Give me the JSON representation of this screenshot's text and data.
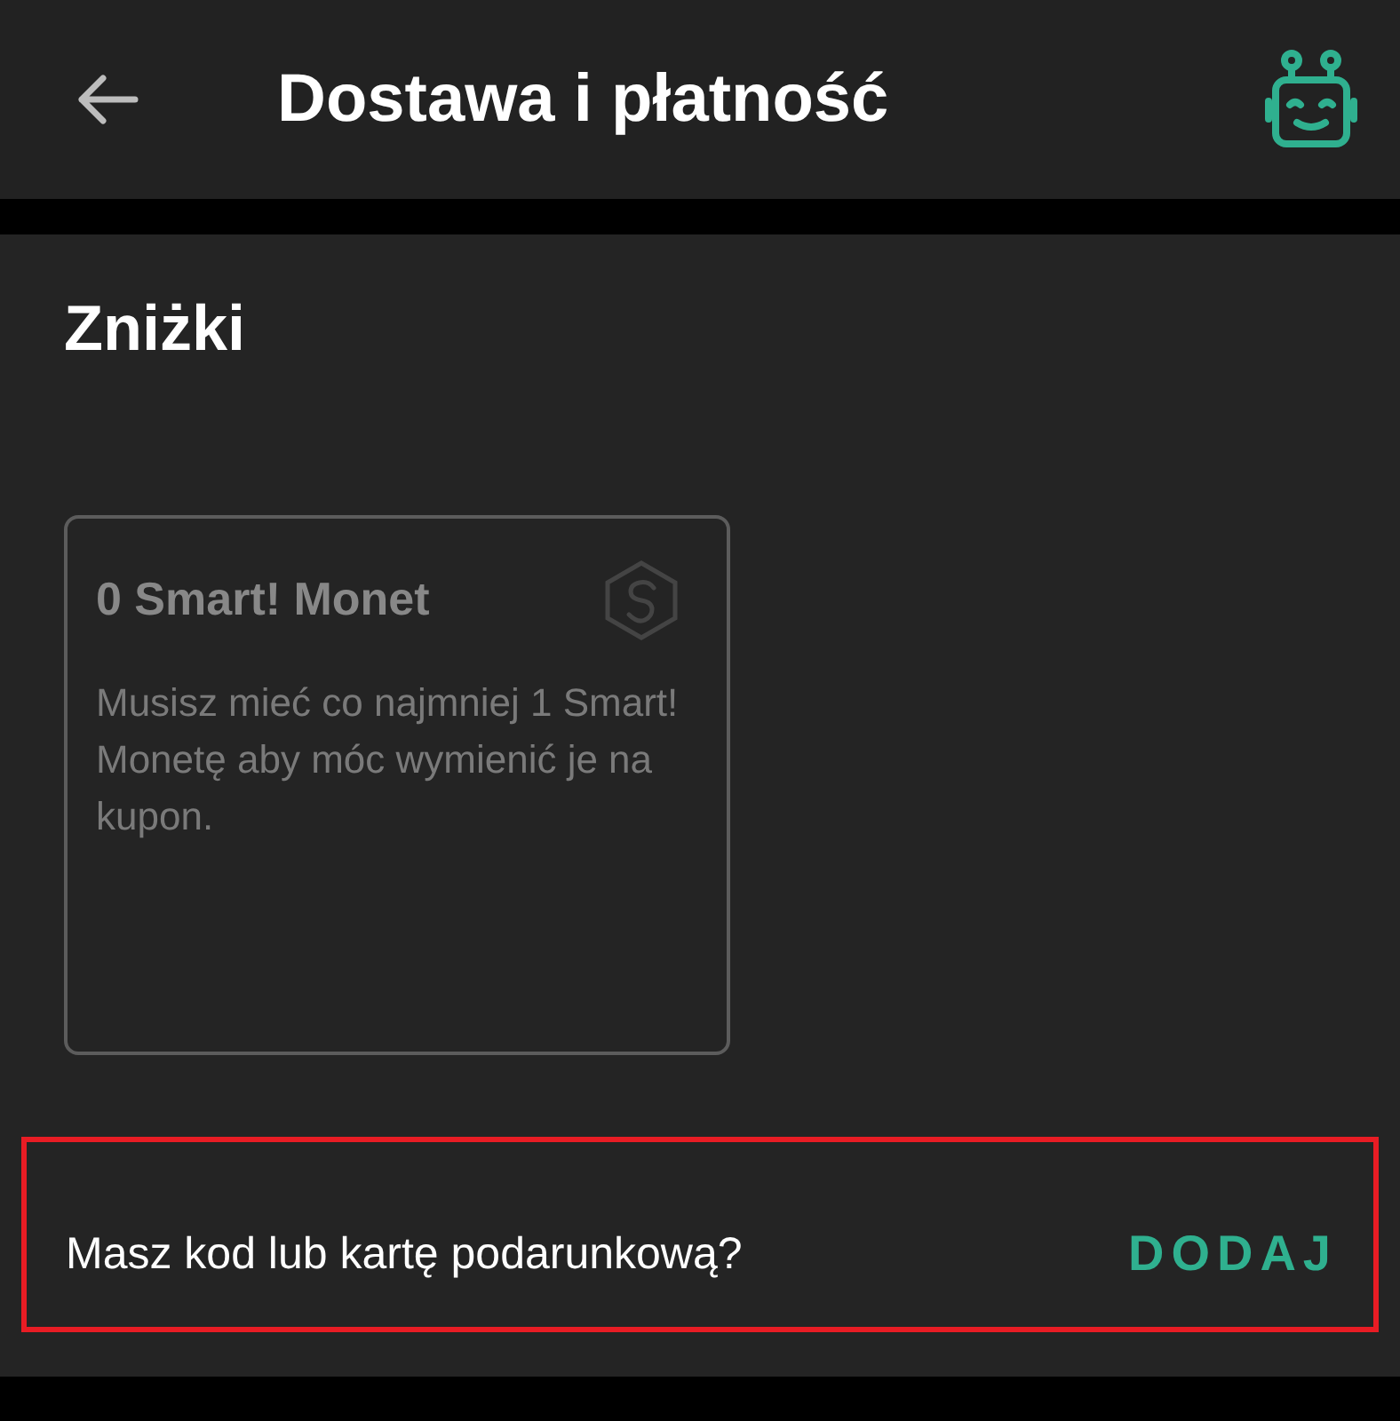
{
  "header": {
    "title": "Dostawa i płatność"
  },
  "section": {
    "title": "Zniżki",
    "card": {
      "title": "0 Smart! Monet",
      "description": "Musisz mieć co najmniej 1 Smart! Monetę aby móc wymienić je na kupon.",
      "disabled": true
    },
    "promo": {
      "label": "Masz kod lub kartę podarunkową?",
      "action": "DODAJ",
      "highlighted": true
    }
  }
}
